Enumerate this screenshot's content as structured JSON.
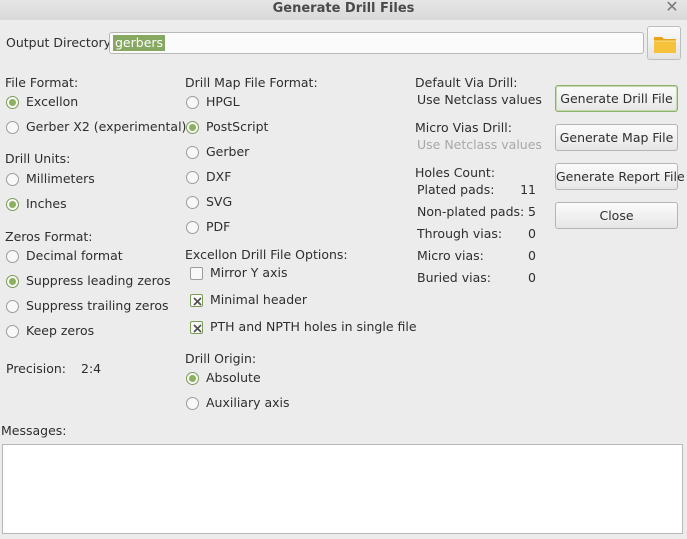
{
  "window": {
    "title": "Generate Drill Files"
  },
  "output": {
    "label": "Output Directory:",
    "value": "gerbers",
    "browse_icon": "folder-icon"
  },
  "file_format": {
    "label": "File Format:",
    "options": [
      {
        "label": "Excellon",
        "selected": true
      },
      {
        "label": "Gerber X2 (experimental)",
        "selected": false
      }
    ]
  },
  "drill_units": {
    "label": "Drill Units:",
    "options": [
      {
        "label": "Millimeters",
        "selected": false
      },
      {
        "label": "Inches",
        "selected": true
      }
    ]
  },
  "zeros_format": {
    "label": "Zeros Format:",
    "options": [
      {
        "label": "Decimal format",
        "selected": false
      },
      {
        "label": "Suppress leading zeros",
        "selected": true
      },
      {
        "label": "Suppress trailing zeros",
        "selected": false
      },
      {
        "label": "Keep zeros",
        "selected": false
      }
    ]
  },
  "precision": {
    "label": "Precision:",
    "value": "2:4"
  },
  "drill_map": {
    "label": "Drill Map File Format:",
    "options": [
      {
        "label": "HPGL",
        "selected": false
      },
      {
        "label": "PostScript",
        "selected": true
      },
      {
        "label": "Gerber",
        "selected": false
      },
      {
        "label": "DXF",
        "selected": false
      },
      {
        "label": "SVG",
        "selected": false
      },
      {
        "label": "PDF",
        "selected": false
      }
    ]
  },
  "excellon_options": {
    "label": "Excellon Drill File Options:",
    "options": [
      {
        "label": "Mirror Y axis",
        "checked": false
      },
      {
        "label": "Minimal header",
        "checked": true
      },
      {
        "label": "PTH and NPTH holes in single file",
        "checked": true
      }
    ]
  },
  "drill_origin": {
    "label": "Drill Origin:",
    "options": [
      {
        "label": "Absolute",
        "selected": true
      },
      {
        "label": "Auxiliary axis",
        "selected": false
      }
    ]
  },
  "via_info": {
    "default_via_label": "Default Via Drill:",
    "default_via_value": "Use Netclass values",
    "micro_via_label": "Micro Vias Drill:",
    "micro_via_value": "Use Netclass values"
  },
  "holes": {
    "label": "Holes Count:",
    "rows": [
      {
        "label": "Plated pads:",
        "value": "11"
      },
      {
        "label": "Non-plated pads:",
        "value": "5"
      },
      {
        "label": "Through vias:",
        "value": "0"
      },
      {
        "label": "Micro vias:",
        "value": "0"
      },
      {
        "label": "Buried vias:",
        "value": "0"
      }
    ]
  },
  "buttons": {
    "generate_drill": "Generate Drill File",
    "generate_map": "Generate Map File",
    "generate_report": "Generate Report File",
    "close": "Close"
  },
  "messages": {
    "label": "Messages:",
    "text": ""
  },
  "colors": {
    "accent": "#8bb05f",
    "selection": "#86a861"
  }
}
